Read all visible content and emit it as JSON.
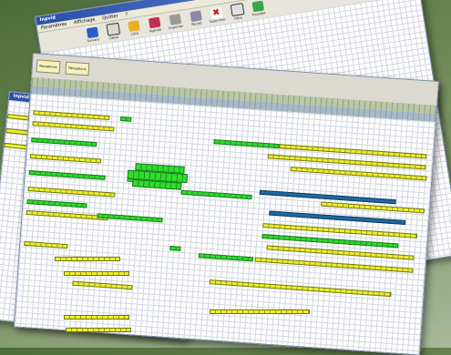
{
  "back_window": {
    "title": "Inpvid",
    "menu": [
      "Paramètres",
      "Affichage",
      "Quitter",
      "?"
    ],
    "tools": [
      {
        "icon": "arrow-icon",
        "label": "Suivant"
      },
      {
        "icon": "list-icon",
        "label": "Détail"
      },
      {
        "icon": "people-icon",
        "label": "Liste"
      },
      {
        "icon": "books-icon",
        "label": "Agenda"
      },
      {
        "icon": "printer-icon",
        "label": "Imprimer"
      },
      {
        "icon": "calculator-icon",
        "label": "Recalc"
      },
      {
        "icon": "delete-icon",
        "label": "Supprimer"
      },
      {
        "icon": "filter-icon",
        "label": "Filtre"
      },
      {
        "icon": "pc-icon",
        "label": "Transfert"
      }
    ]
  },
  "mid_window": {
    "buttons": [
      "Réceptions",
      "Réceptions"
    ]
  },
  "small_window": {
    "title": "Inpvid"
  },
  "colors": {
    "bar_yellow": "#f2ee2a",
    "bar_green": "#2fdd2f",
    "bar_blue": "#1f6aa0",
    "title_blue": "#2a4fa8"
  }
}
